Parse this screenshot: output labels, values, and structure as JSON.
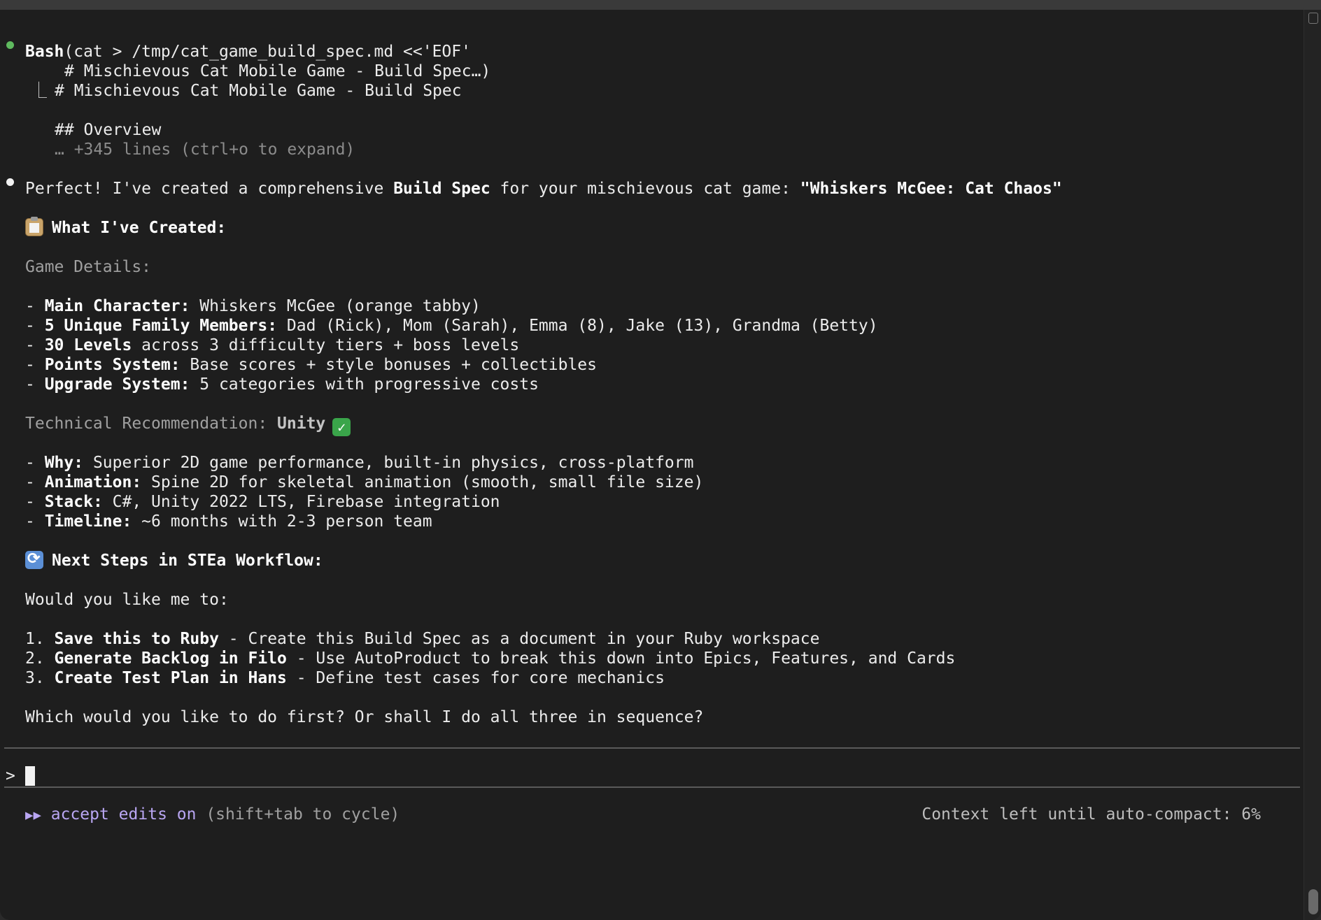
{
  "bash_block": {
    "tool": "Bash",
    "command": "(cat > /tmp/cat_game_build_spec.md <<'EOF'",
    "command_line2": "# Mischievous Cat Mobile Game - Build Spec…)",
    "result_line1": "# Mischievous Cat Mobile Game - Build Spec",
    "result_line2": "## Overview",
    "result_more": "… +345 lines (ctrl+o to expand)"
  },
  "response": {
    "intro_pre": "Perfect! I've created a comprehensive ",
    "intro_bold1": "Build Spec",
    "intro_mid": " for your mischievous cat game: ",
    "intro_bold2": "\"Whiskers McGee: Cat Chaos\"",
    "section1_title": "What I've Created:",
    "section1_sub": "Game Details:",
    "details": [
      {
        "label": "Main Character:",
        "text": " Whiskers McGee (orange tabby)"
      },
      {
        "label": "5 Unique Family Members:",
        "text": " Dad (Rick), Mom (Sarah), Emma (8), Jake (13), Grandma (Betty)"
      },
      {
        "label": "30 Levels",
        "text": " across 3 difficulty tiers + boss levels"
      },
      {
        "label": "Points System:",
        "text": " Base scores + style bonuses + collectibles"
      },
      {
        "label": "Upgrade System:",
        "text": " 5 categories with progressive costs"
      }
    ],
    "tech_label": "Technical Recommendation: ",
    "tech_value": "Unity",
    "tech_items": [
      {
        "label": "Why:",
        "text": " Superior 2D game performance, built-in physics, cross-platform"
      },
      {
        "label": "Animation:",
        "text": " Spine 2D for skeletal animation (smooth, small file size)"
      },
      {
        "label": "Stack:",
        "text": " C#, Unity 2022 LTS, Firebase integration"
      },
      {
        "label": "Timeline:",
        "text": " ~6 months with 2-3 person team"
      }
    ],
    "section2_title": "Next Steps in STEa Workflow:",
    "question": "Would you like me to:",
    "steps": [
      {
        "num": "1. ",
        "label": "Save this to Ruby",
        "text": " - Create this Build Spec as a document in your Ruby workspace"
      },
      {
        "num": "2. ",
        "label": "Generate Backlog in Filo",
        "text": " - Use AutoProduct to break this down into Epics, Features, and Cards"
      },
      {
        "num": "3. ",
        "label": "Create Test Plan in Hans",
        "text": " - Define test cases for core mechanics"
      }
    ],
    "closing": "Which would you like to do first? Or shall I do all three in sequence?"
  },
  "prompt": {
    "symbol": ">",
    "value": ""
  },
  "status": {
    "mode_arrows": "▶▶",
    "mode_text": "accept edits on",
    "mode_hint": " (shift+tab to cycle)",
    "context": "Context left until auto-compact: 6%"
  },
  "colors": {
    "tool_bullet": "#5fba5f",
    "response_bullet": "#f2f2f2",
    "accept_mode": "#b9a6f2",
    "background": "#1e1e1e"
  },
  "icons": {
    "section1": "clipboard-icon",
    "tech_check": "check-mark-icon",
    "section2": "cycle-arrows-icon"
  }
}
